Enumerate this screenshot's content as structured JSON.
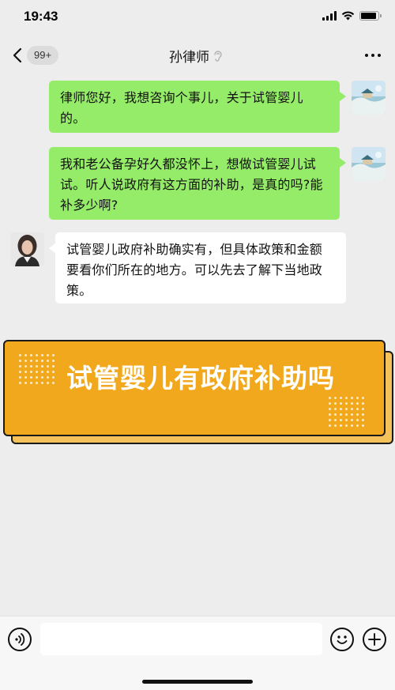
{
  "status_bar": {
    "time": "19:43",
    "battery_level": 0.9
  },
  "nav": {
    "back_icon": "chevron-left-icon",
    "unread_count": "99+",
    "title": "孙律师",
    "ear_icon": "ear-icon",
    "more_icon": "more-dots-icon"
  },
  "messages": [
    {
      "sender": "me",
      "text": "律师您好，我想咨询个事儿，关于试管婴儿的。"
    },
    {
      "sender": "me",
      "text": "我和老公备孕好久都没怀上，想做试管婴儿试试。听人说政府有这方面的补助，是真的吗?能补多少啊?"
    },
    {
      "sender": "lawyer",
      "text": "试管婴儿政府补助确实有，但具体政策和金额要看你们所在的地方。可以先去了解下当地政策。"
    }
  ],
  "banner": {
    "title": "试管婴儿有政府补助吗"
  },
  "input_bar": {
    "voice_icon": "voice-icon",
    "emoji_icon": "emoji-icon",
    "plus_icon": "plus-icon",
    "input_value": ""
  },
  "colors": {
    "outgoing_bubble": "#95ec69",
    "incoming_bubble": "#ffffff",
    "banner": "#f2a81d",
    "background": "#ededed"
  }
}
